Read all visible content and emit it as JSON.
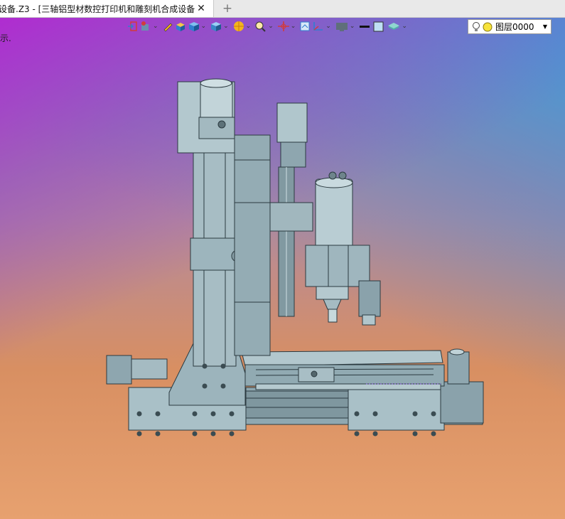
{
  "tab": {
    "title": "设备.Z3 - [三轴铝型材数控打印机和雕刻机合成设备]",
    "close_glyph": "✕",
    "new_tab_glyph": "+"
  },
  "viewport": {
    "hint_text": "示."
  },
  "toolbar": {
    "buttons": [
      "exit-icon",
      "component-icon",
      "pen-icon",
      "shaded-box-icon",
      "cube-icon",
      "view-cube-icon",
      "render-sphere-icon",
      "zoom-icon",
      "pan-icon",
      "fit-view-icon",
      "axis-icon",
      "display-icon",
      "line-style-icon",
      "color-swatch-icon",
      "layer-plane-icon"
    ],
    "colors": {
      "accent_red": "#d23b3b",
      "accent_blue": "#2f7fd0",
      "accent_yellow": "#f3b51d"
    }
  },
  "layer": {
    "value": "图层0000",
    "bulb_icon": "lightbulb-icon",
    "state_icon": "yellow-dot-icon"
  },
  "model": {
    "description_colors": {
      "metal": "#9fb8c0",
      "shade": "#6f8890",
      "line": "#2b3a40"
    }
  }
}
